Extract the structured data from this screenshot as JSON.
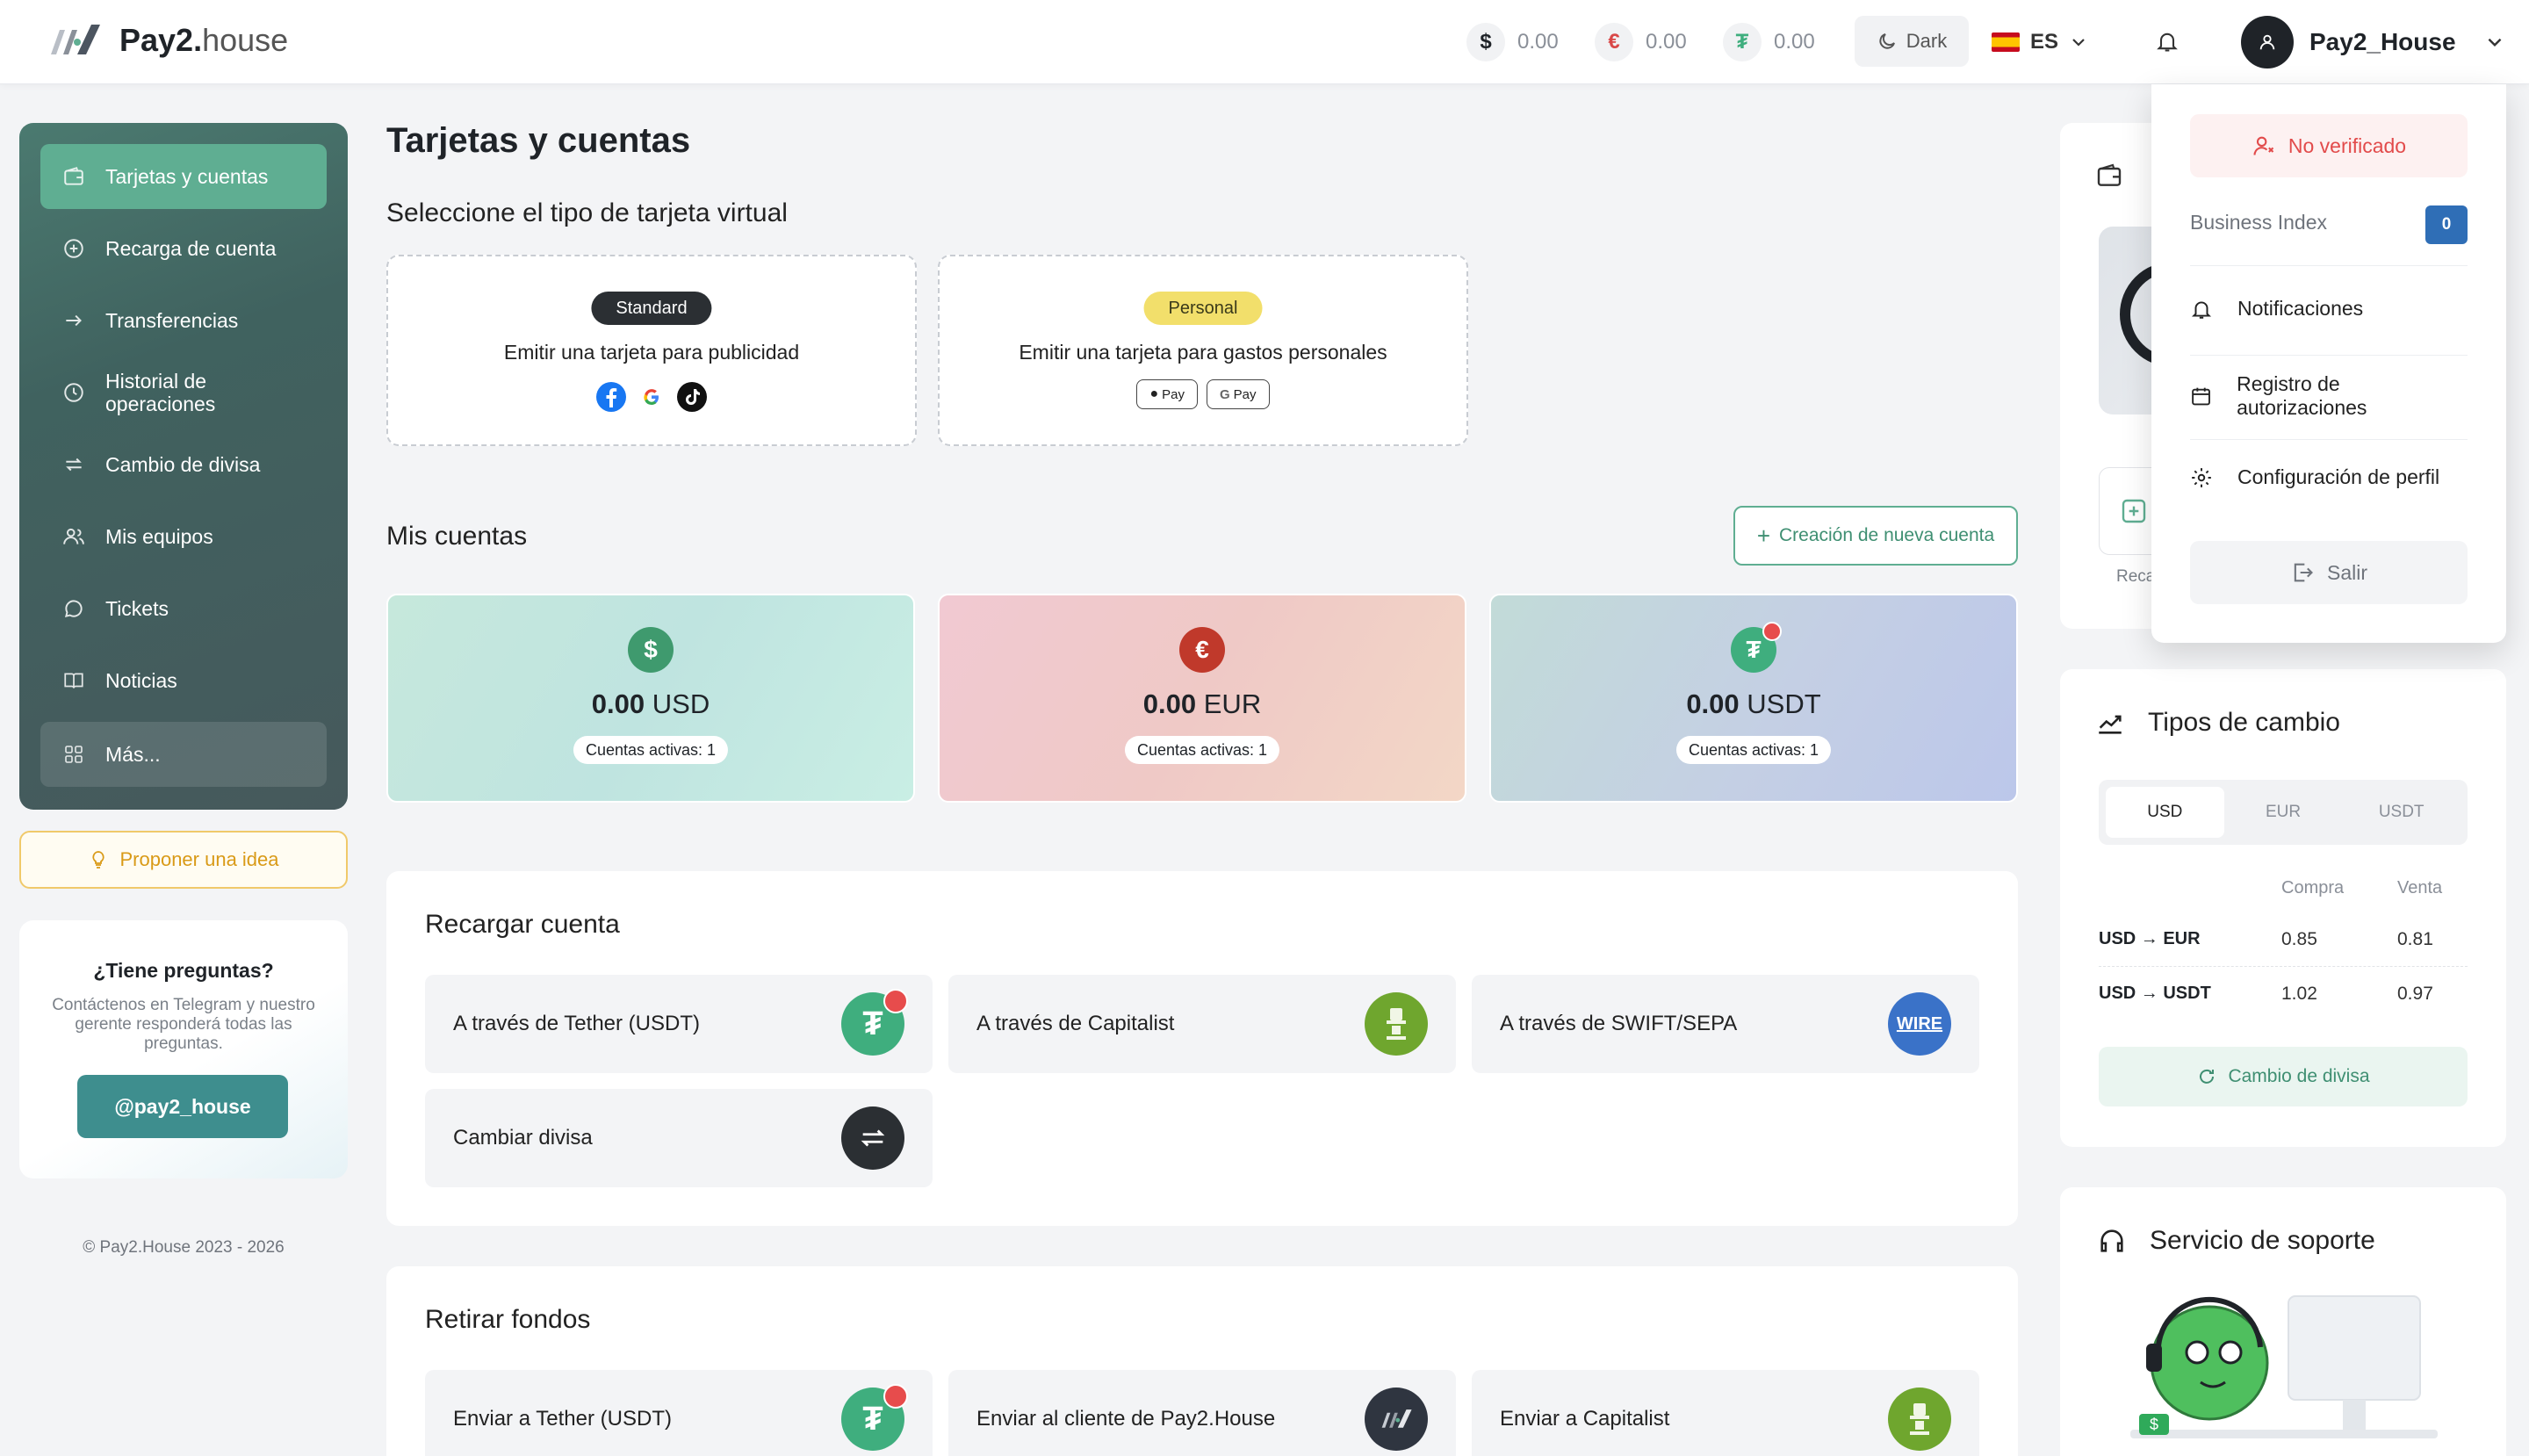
{
  "app": {
    "name_bold": "Pay2.",
    "name_light": "house"
  },
  "header": {
    "balances": [
      {
        "symbol": "$",
        "amount": "0.00",
        "color": "#1f2328"
      },
      {
        "symbol": "€",
        "amount": "0.00",
        "color": "#d94848"
      },
      {
        "symbol": "₮",
        "amount": "0.00",
        "color": "#3fae7e"
      }
    ],
    "theme_label": "Dark",
    "language": "ES",
    "username": "Pay2_House"
  },
  "sidebar": {
    "items": [
      {
        "label": "Tarjetas y cuentas",
        "icon": "wallet-icon"
      },
      {
        "label": "Recarga de cuenta",
        "icon": "plus-circle-icon"
      },
      {
        "label": "Transferencias",
        "icon": "arrow-right-icon"
      },
      {
        "label": "Historial de operaciones",
        "icon": "clock-icon"
      },
      {
        "label": "Cambio de divisa",
        "icon": "exchange-icon"
      },
      {
        "label": "Mis equipos",
        "icon": "users-icon"
      },
      {
        "label": "Tickets",
        "icon": "chat-icon"
      },
      {
        "label": "Noticias",
        "icon": "book-icon"
      },
      {
        "label": "Más...",
        "icon": "grid-icon"
      }
    ],
    "idea_button": "Proponer una idea",
    "faq": {
      "title": "¿Tiene preguntas?",
      "text": "Contáctenos en Telegram y nuestro gerente responderá todas las preguntas.",
      "button": "@pay2_house"
    },
    "copyright": "© Pay2.House 2023 - 2026"
  },
  "main": {
    "title": "Tarjetas y cuentas",
    "virtual_title": "Seleccione el tipo de tarjeta virtual",
    "cards": [
      {
        "badge": "Standard",
        "desc": "Emitir una tarjeta para publicidad"
      },
      {
        "badge": "Personal",
        "desc": "Emitir una tarjeta para gastos personales",
        "pay1": "Pay",
        "pay2": "Pay"
      }
    ],
    "accounts_title": "Mis cuentas",
    "new_account": "Creación de nueva cuenta",
    "accounts": [
      {
        "symbol": "$",
        "amount": "0.00",
        "currency": "USD",
        "active": "Cuentas activas: 1",
        "color": "#3f9a6e"
      },
      {
        "symbol": "€",
        "amount": "0.00",
        "currency": "EUR",
        "active": "Cuentas activas: 1",
        "color": "#c0392b"
      },
      {
        "symbol": "₮",
        "amount": "0.00",
        "currency": "USDT",
        "active": "Cuentas activas: 1",
        "color": "#3fae7e"
      }
    ],
    "topup": {
      "title": "Recargar cuenta",
      "options": [
        "A través de Tether (USDT)",
        "A través de Capitalist",
        "A través de SWIFT/SEPA",
        "Cambiar divisa"
      ],
      "wire_label": "WIRE"
    },
    "withdraw": {
      "title": "Retirar fondos",
      "options": [
        "Enviar a Tether (USDT)",
        "Enviar al cliente de Pay2.House",
        "Enviar a Capitalist"
      ]
    }
  },
  "right": {
    "partial_label": "Reca",
    "rates": {
      "title": "Tipos de cambio",
      "tabs": [
        "USD",
        "EUR",
        "USDT"
      ],
      "col_buy": "Compra",
      "col_sell": "Venta",
      "rows": [
        {
          "pair": "USD → EUR",
          "buy": "0.85",
          "sell": "0.81"
        },
        {
          "pair": "USD → USDT",
          "buy": "1.02",
          "sell": "0.97"
        }
      ],
      "button": "Cambio de divisa"
    },
    "support_title": "Servicio de soporte"
  },
  "dropdown": {
    "status": "No verificado",
    "business_index_label": "Business Index",
    "business_index_value": "0",
    "items": [
      "Notificaciones",
      "Registro de autorizaciones",
      "Configuración de perfil"
    ],
    "logout": "Salir"
  }
}
